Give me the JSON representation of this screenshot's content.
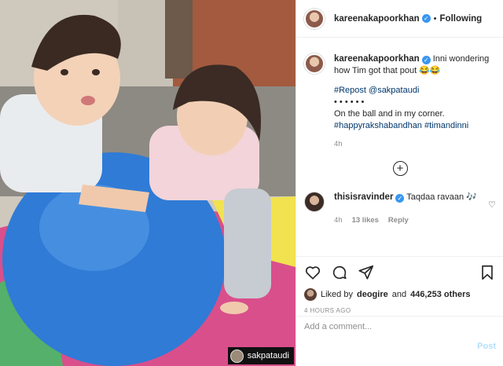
{
  "photo": {
    "watermark_user": "sakpataudi"
  },
  "header": {
    "username": "kareenakapoorkhan",
    "follow_label": "Following",
    "separator": "•"
  },
  "caption": {
    "username": "kareenakapoorkhan",
    "line1": "Inni wondering how Tim got that pout 😂😂",
    "line2": "#Repost @sakpataudi",
    "line3": "• • • • • •",
    "line4": "On the ball and in my corner.",
    "line5": "#happyrakshabandhan #timandinni",
    "time": "4h"
  },
  "reply": {
    "username": "thisisravinder",
    "text": "Taqdaa ravaan 🎶",
    "time": "4h",
    "likes": "13 likes",
    "reply_label": "Reply"
  },
  "actions": {
    "liked_by_prefix": "Liked by",
    "liked_by_user": "deogire",
    "liked_and": "and",
    "liked_others": "446,253 others",
    "post_time": "4 HOURS AGO",
    "comment_placeholder": "Add a comment...",
    "post_label": "Post"
  },
  "icons": {
    "verified": "verified-badge-icon",
    "load_more": "plus-circle-icon",
    "like": "heart-icon",
    "comment": "comment-bubble-icon",
    "share": "paper-plane-icon",
    "save": "bookmark-icon"
  },
  "colors": {
    "verified_blue": "#3897f0",
    "link": "#00376b",
    "muted": "#8e8e8e",
    "post_disabled": "#b2dffc"
  }
}
